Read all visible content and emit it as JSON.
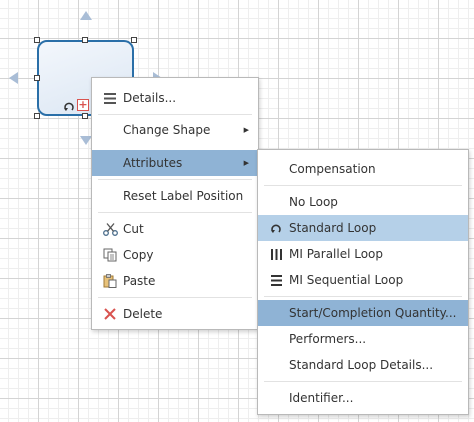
{
  "context_menu": {
    "details": "Details...",
    "change_shape": "Change Shape",
    "attributes": "Attributes",
    "reset_label_position": "Reset Label Position",
    "cut": "Cut",
    "copy": "Copy",
    "paste": "Paste",
    "delete": "Delete",
    "submenu_arrow": "▶"
  },
  "attributes_submenu": {
    "compensation": "Compensation",
    "no_loop": "No Loop",
    "standard_loop": "Standard Loop",
    "mi_parallel_loop": "MI Parallel Loop",
    "mi_sequential_loop": "MI Sequential Loop",
    "start_completion_quantity": "Start/Completion Quantity...",
    "performers": "Performers...",
    "standard_loop_details": "Standard Loop Details...",
    "identifier": "Identifier..."
  },
  "task_markers": {
    "collapsed_subprocess": "+"
  },
  "colors": {
    "selection_highlight": "#8fb3d5",
    "hover_highlight": "#b5d0e8",
    "task_border": "#2a6fa8",
    "delete_icon": "#d9534f"
  }
}
